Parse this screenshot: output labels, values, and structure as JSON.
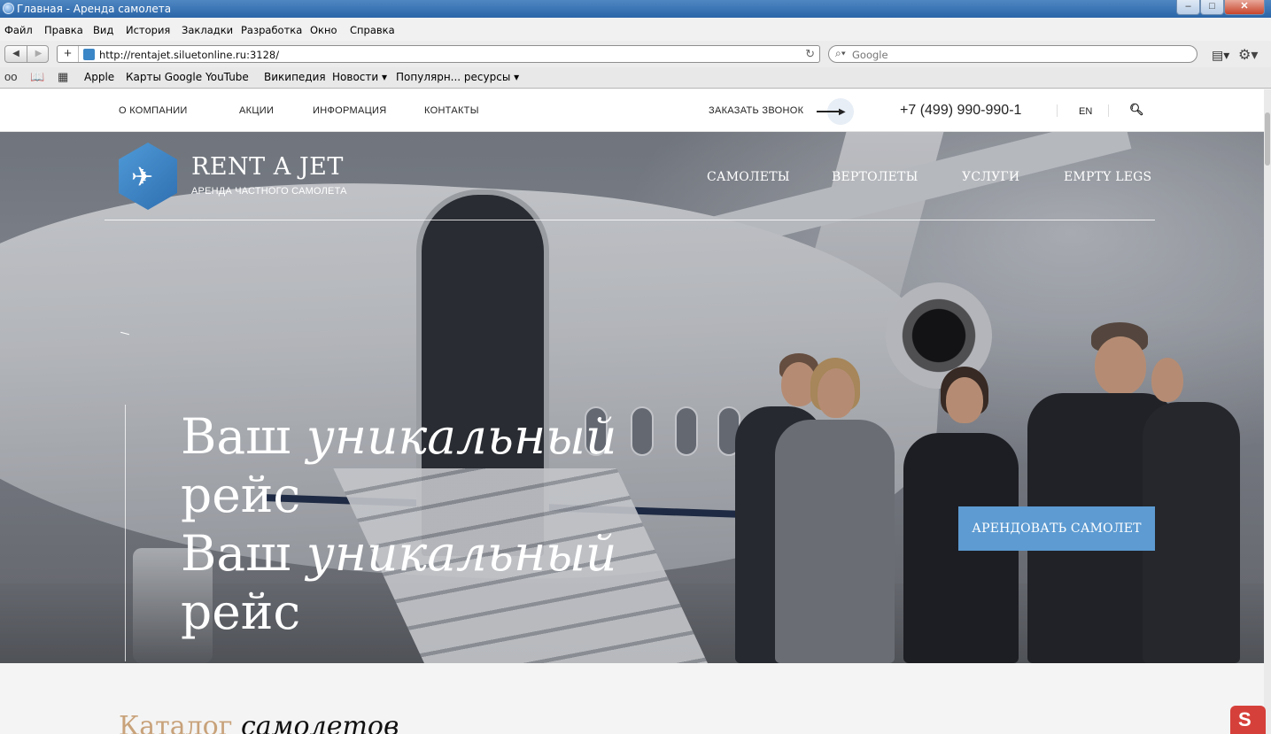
{
  "browser": {
    "window_title": "Главная - Аренда самолета",
    "menu": [
      "Файл",
      "Правка",
      "Вид",
      "История",
      "Закладки",
      "Разработка",
      "Окно",
      "Справка"
    ],
    "url": "http://rentajet.siluetonline.ru:3128/",
    "search_placeholder": "Google",
    "bookmarks": [
      "Apple",
      "Карты Google",
      "YouTube",
      "Википедия",
      "Новости ▾",
      "Популярн... ресурсы ▾"
    ]
  },
  "site": {
    "top_nav": [
      "О КОМПАНИИ",
      "АКЦИИ",
      "ИНФОРМАЦИЯ",
      "КОНТАКТЫ"
    ],
    "callback": "ЗАКАЗАТЬ ЗВОНОК",
    "phone": "+7 (499) 990-990-1",
    "lang": "EN",
    "brand": {
      "name": "RENT A JET",
      "tagline": "АРЕНДА ЧАСТНОГО САМОЛЕТА"
    },
    "main_nav": [
      "САМОЛЕТЫ",
      "ВЕРТОЛЕТЫ",
      "УСЛУГИ",
      "EMPTY LEGS"
    ],
    "hero": {
      "lines": [
        {
          "plain": "Ваш ",
          "em": "уникальный",
          "rest": "рейс"
        },
        {
          "plain": "Ваш ",
          "em": "уникальный",
          "rest": "рейс"
        }
      ],
      "cta": "АРЕНДОВАТЬ САМОЛЕТ"
    },
    "catalog": {
      "plain": "Каталог ",
      "em": "самолетов"
    }
  },
  "colors": {
    "accent": "#5d9bd2",
    "catalog_gold": "#c8a27a",
    "titlebar": "#2a65a8"
  }
}
